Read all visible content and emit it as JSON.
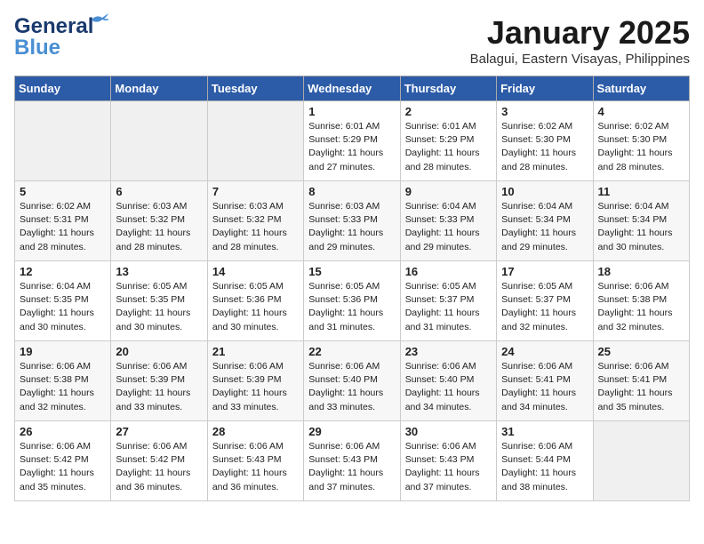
{
  "header": {
    "logo_line1": "General",
    "logo_line2": "Blue",
    "month_title": "January 2025",
    "location": "Balagui, Eastern Visayas, Philippines"
  },
  "weekdays": [
    "Sunday",
    "Monday",
    "Tuesday",
    "Wednesday",
    "Thursday",
    "Friday",
    "Saturday"
  ],
  "weeks": [
    [
      {
        "day": "",
        "sunrise": "",
        "sunset": "",
        "daylight": ""
      },
      {
        "day": "",
        "sunrise": "",
        "sunset": "",
        "daylight": ""
      },
      {
        "day": "",
        "sunrise": "",
        "sunset": "",
        "daylight": ""
      },
      {
        "day": "1",
        "sunrise": "Sunrise: 6:01 AM",
        "sunset": "Sunset: 5:29 PM",
        "daylight": "Daylight: 11 hours and 27 minutes."
      },
      {
        "day": "2",
        "sunrise": "Sunrise: 6:01 AM",
        "sunset": "Sunset: 5:29 PM",
        "daylight": "Daylight: 11 hours and 28 minutes."
      },
      {
        "day": "3",
        "sunrise": "Sunrise: 6:02 AM",
        "sunset": "Sunset: 5:30 PM",
        "daylight": "Daylight: 11 hours and 28 minutes."
      },
      {
        "day": "4",
        "sunrise": "Sunrise: 6:02 AM",
        "sunset": "Sunset: 5:30 PM",
        "daylight": "Daylight: 11 hours and 28 minutes."
      }
    ],
    [
      {
        "day": "5",
        "sunrise": "Sunrise: 6:02 AM",
        "sunset": "Sunset: 5:31 PM",
        "daylight": "Daylight: 11 hours and 28 minutes."
      },
      {
        "day": "6",
        "sunrise": "Sunrise: 6:03 AM",
        "sunset": "Sunset: 5:32 PM",
        "daylight": "Daylight: 11 hours and 28 minutes."
      },
      {
        "day": "7",
        "sunrise": "Sunrise: 6:03 AM",
        "sunset": "Sunset: 5:32 PM",
        "daylight": "Daylight: 11 hours and 28 minutes."
      },
      {
        "day": "8",
        "sunrise": "Sunrise: 6:03 AM",
        "sunset": "Sunset: 5:33 PM",
        "daylight": "Daylight: 11 hours and 29 minutes."
      },
      {
        "day": "9",
        "sunrise": "Sunrise: 6:04 AM",
        "sunset": "Sunset: 5:33 PM",
        "daylight": "Daylight: 11 hours and 29 minutes."
      },
      {
        "day": "10",
        "sunrise": "Sunrise: 6:04 AM",
        "sunset": "Sunset: 5:34 PM",
        "daylight": "Daylight: 11 hours and 29 minutes."
      },
      {
        "day": "11",
        "sunrise": "Sunrise: 6:04 AM",
        "sunset": "Sunset: 5:34 PM",
        "daylight": "Daylight: 11 hours and 30 minutes."
      }
    ],
    [
      {
        "day": "12",
        "sunrise": "Sunrise: 6:04 AM",
        "sunset": "Sunset: 5:35 PM",
        "daylight": "Daylight: 11 hours and 30 minutes."
      },
      {
        "day": "13",
        "sunrise": "Sunrise: 6:05 AM",
        "sunset": "Sunset: 5:35 PM",
        "daylight": "Daylight: 11 hours and 30 minutes."
      },
      {
        "day": "14",
        "sunrise": "Sunrise: 6:05 AM",
        "sunset": "Sunset: 5:36 PM",
        "daylight": "Daylight: 11 hours and 30 minutes."
      },
      {
        "day": "15",
        "sunrise": "Sunrise: 6:05 AM",
        "sunset": "Sunset: 5:36 PM",
        "daylight": "Daylight: 11 hours and 31 minutes."
      },
      {
        "day": "16",
        "sunrise": "Sunrise: 6:05 AM",
        "sunset": "Sunset: 5:37 PM",
        "daylight": "Daylight: 11 hours and 31 minutes."
      },
      {
        "day": "17",
        "sunrise": "Sunrise: 6:05 AM",
        "sunset": "Sunset: 5:37 PM",
        "daylight": "Daylight: 11 hours and 32 minutes."
      },
      {
        "day": "18",
        "sunrise": "Sunrise: 6:06 AM",
        "sunset": "Sunset: 5:38 PM",
        "daylight": "Daylight: 11 hours and 32 minutes."
      }
    ],
    [
      {
        "day": "19",
        "sunrise": "Sunrise: 6:06 AM",
        "sunset": "Sunset: 5:38 PM",
        "daylight": "Daylight: 11 hours and 32 minutes."
      },
      {
        "day": "20",
        "sunrise": "Sunrise: 6:06 AM",
        "sunset": "Sunset: 5:39 PM",
        "daylight": "Daylight: 11 hours and 33 minutes."
      },
      {
        "day": "21",
        "sunrise": "Sunrise: 6:06 AM",
        "sunset": "Sunset: 5:39 PM",
        "daylight": "Daylight: 11 hours and 33 minutes."
      },
      {
        "day": "22",
        "sunrise": "Sunrise: 6:06 AM",
        "sunset": "Sunset: 5:40 PM",
        "daylight": "Daylight: 11 hours and 33 minutes."
      },
      {
        "day": "23",
        "sunrise": "Sunrise: 6:06 AM",
        "sunset": "Sunset: 5:40 PM",
        "daylight": "Daylight: 11 hours and 34 minutes."
      },
      {
        "day": "24",
        "sunrise": "Sunrise: 6:06 AM",
        "sunset": "Sunset: 5:41 PM",
        "daylight": "Daylight: 11 hours and 34 minutes."
      },
      {
        "day": "25",
        "sunrise": "Sunrise: 6:06 AM",
        "sunset": "Sunset: 5:41 PM",
        "daylight": "Daylight: 11 hours and 35 minutes."
      }
    ],
    [
      {
        "day": "26",
        "sunrise": "Sunrise: 6:06 AM",
        "sunset": "Sunset: 5:42 PM",
        "daylight": "Daylight: 11 hours and 35 minutes."
      },
      {
        "day": "27",
        "sunrise": "Sunrise: 6:06 AM",
        "sunset": "Sunset: 5:42 PM",
        "daylight": "Daylight: 11 hours and 36 minutes."
      },
      {
        "day": "28",
        "sunrise": "Sunrise: 6:06 AM",
        "sunset": "Sunset: 5:43 PM",
        "daylight": "Daylight: 11 hours and 36 minutes."
      },
      {
        "day": "29",
        "sunrise": "Sunrise: 6:06 AM",
        "sunset": "Sunset: 5:43 PM",
        "daylight": "Daylight: 11 hours and 37 minutes."
      },
      {
        "day": "30",
        "sunrise": "Sunrise: 6:06 AM",
        "sunset": "Sunset: 5:43 PM",
        "daylight": "Daylight: 11 hours and 37 minutes."
      },
      {
        "day": "31",
        "sunrise": "Sunrise: 6:06 AM",
        "sunset": "Sunset: 5:44 PM",
        "daylight": "Daylight: 11 hours and 38 minutes."
      },
      {
        "day": "",
        "sunrise": "",
        "sunset": "",
        "daylight": ""
      }
    ]
  ]
}
